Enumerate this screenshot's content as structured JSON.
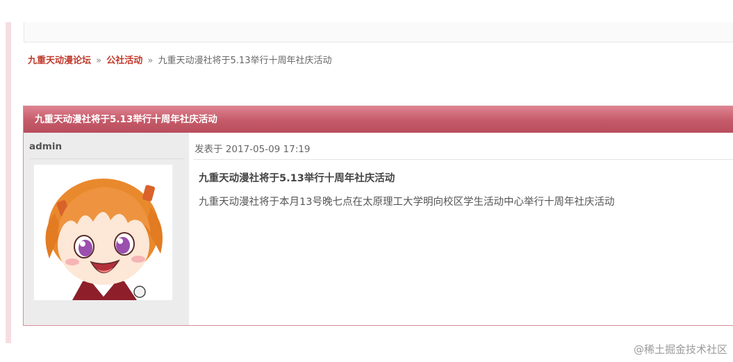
{
  "breadcrumb": {
    "forum": "九重天动漫论坛",
    "separator": "»",
    "category": "公社活动",
    "current": "九重天动漫社将于5.13举行十周年社庆活动"
  },
  "post": {
    "header_title": "九重天动漫社将于5.13举行十周年社庆活动",
    "author": "admin",
    "posted_label": "发表于 2017-05-09 17:19",
    "title": "九重天动漫社将于5.13举行十周年社庆活动",
    "content": "九重天动漫社将于本月13号晚七点在太原理工大学明向校区学生活动中心举行十周年社庆活动"
  },
  "watermark": "@稀土掘金技术社区",
  "colors": {
    "header_start": "#dd8390",
    "header_end": "#b84d5c",
    "link": "#c0392b",
    "side_bar": "#f6dde1"
  },
  "icons": {
    "avatar": "anime-girl-avatar"
  }
}
